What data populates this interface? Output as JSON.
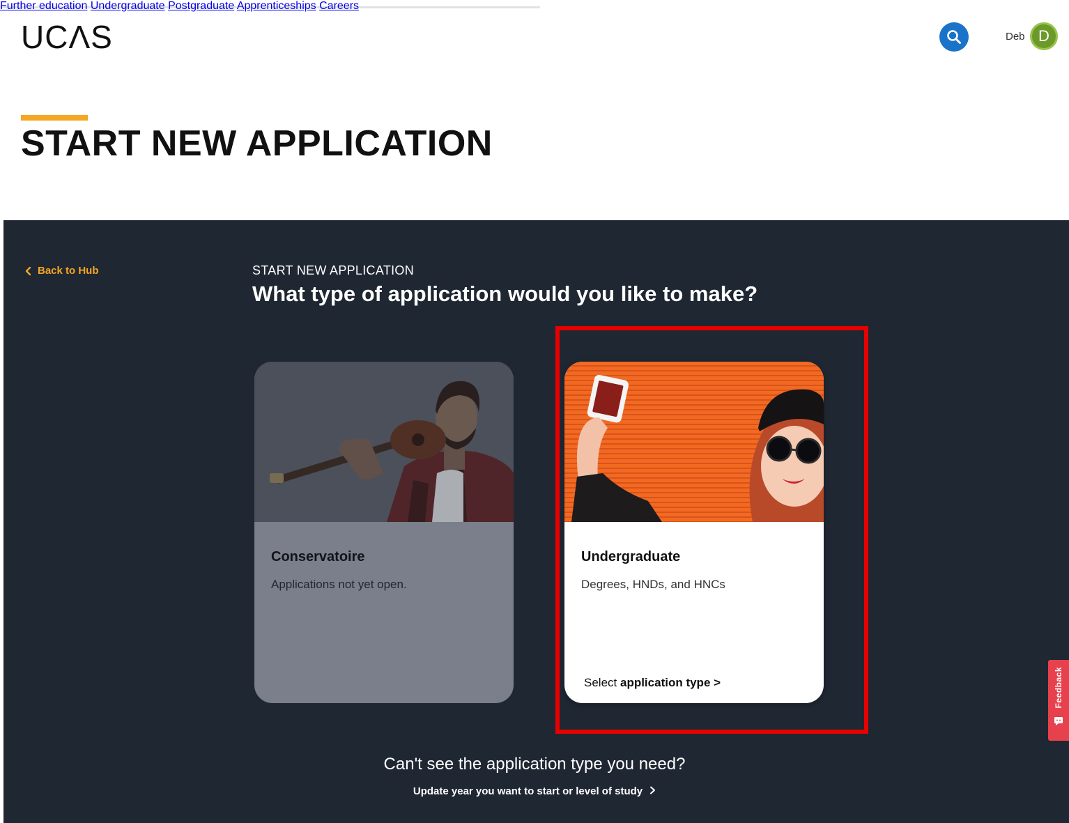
{
  "header": {
    "logo": "UCΛS",
    "nav": [
      {
        "label": "Further education"
      },
      {
        "label": "Undergraduate"
      },
      {
        "label": "Postgraduate"
      },
      {
        "label": "Apprenticeships"
      },
      {
        "label": "Careers"
      }
    ],
    "search_icon": "search-icon",
    "user_name": "Deb",
    "avatar_initial": "D"
  },
  "page": {
    "title": "START NEW APPLICATION"
  },
  "panel": {
    "back_label": "Back to Hub",
    "eyebrow": "START NEW APPLICATION",
    "question": "What type of application would you like to make?",
    "cards": [
      {
        "title": "Conservatoire",
        "description": "Applications not yet open.",
        "image": "man-with-guitar-photo",
        "state": "disabled"
      },
      {
        "title": "Undergraduate",
        "description": "Degrees, HNDs, and HNCs",
        "image": "woman-taking-selfie-photo",
        "select_prefix": "Select",
        "select_strong": "application type >"
      }
    ],
    "cant_see": "Can't see the application type you need?",
    "update_link": "Update year you want to start or level of study"
  },
  "feedback": {
    "label": "Feedback"
  },
  "colors": {
    "panel_bg": "#1f2732",
    "accent": "#f5a623",
    "search_blue": "#1a73c9",
    "avatar_green": "#6b9a2b",
    "feedback_red": "#e8414e",
    "highlight_red": "#e60000"
  }
}
